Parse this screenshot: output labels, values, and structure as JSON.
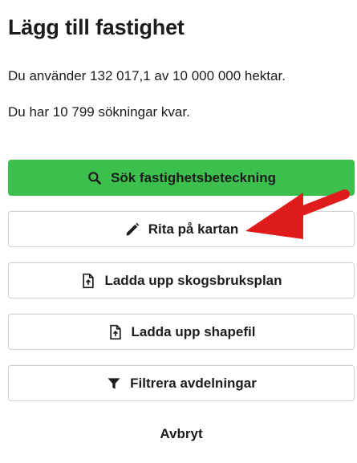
{
  "dialog": {
    "title": "Lägg till fastighet",
    "usage_text": "Du använder 132 017,1 av 10 000 000 hektar.",
    "searches_text": "Du har 10 799 sökningar kvar."
  },
  "buttons": {
    "search_label": "Sök fastighetsbeteckning",
    "draw_label": "Rita på kartan",
    "upload_plan_label": "Ladda upp skogsbruksplan",
    "upload_shapefile_label": "Ladda upp shapefil",
    "filter_label": "Filtrera avdelningar",
    "cancel_label": "Avbryt"
  },
  "icons": {
    "search": "search-icon",
    "draw": "pencil-icon",
    "upload_plan": "file-upload-icon",
    "upload_shapefile": "file-upload-icon",
    "filter": "filter-icon",
    "annotation": "red-arrow"
  },
  "colors": {
    "primary": "#3cbf4c",
    "annotation_arrow": "#e01b1b"
  }
}
